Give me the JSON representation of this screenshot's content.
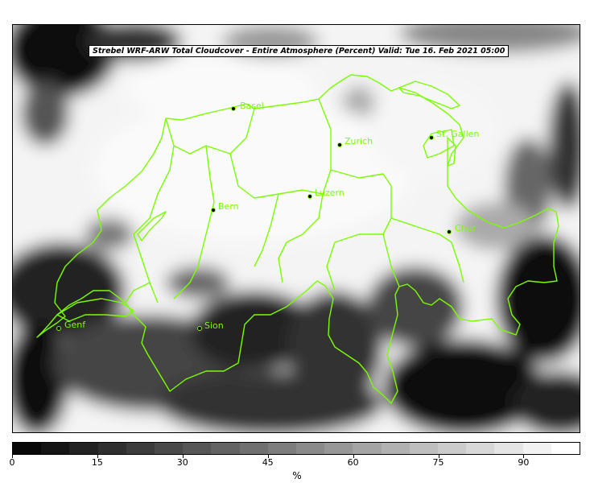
{
  "title": "Strebel WRF-ARW Total Cloudcover - Entire Atmosphere (Percent)   Valid: Tue 16. Feb 2021 05:00",
  "cities": [
    {
      "name": "Basel"
    },
    {
      "name": "Zurich"
    },
    {
      "name": "St. Gallen"
    },
    {
      "name": "Luzern"
    },
    {
      "name": "Bern"
    },
    {
      "name": "Chur"
    },
    {
      "name": "Genf"
    },
    {
      "name": "Sion"
    }
  ],
  "colorbar": {
    "min": 0,
    "max": 100,
    "ticks": [
      "0",
      "15",
      "30",
      "45",
      "60",
      "75",
      "90"
    ],
    "unit": "%"
  },
  "colors": {
    "border_line": "#7cfc00",
    "label": "#7cfc00"
  }
}
